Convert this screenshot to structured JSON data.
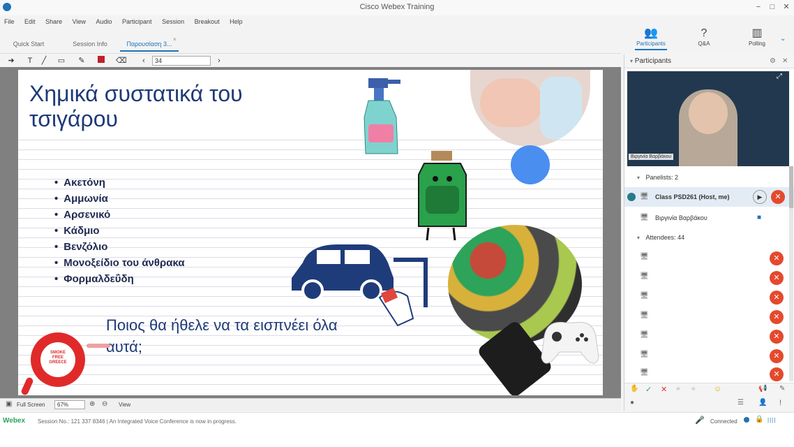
{
  "window": {
    "title": "Cisco Webex Training"
  },
  "menu": [
    "File",
    "Edit",
    "Share",
    "View",
    "Audio",
    "Participant",
    "Session",
    "Breakout",
    "Help"
  ],
  "tabs": [
    {
      "label": "Quick Start"
    },
    {
      "label": "Session Info"
    },
    {
      "label": "Παρουσίαση 3..."
    }
  ],
  "top_icons": [
    {
      "label": "Participants",
      "icon": "participants-icon"
    },
    {
      "label": "Q&A",
      "icon": "qa-icon"
    },
    {
      "label": "Polling",
      "icon": "polling-icon"
    }
  ],
  "annotation_toolbar": {
    "page_value": "34"
  },
  "slide": {
    "title": "Χημικά συστατικά του τσιγάρου",
    "bullets": [
      "Ακετόνη",
      "Αμμωνία",
      "Αρσενικό",
      "Κάδμιο",
      "Βενζόλιο",
      "Μονοξείδιο του άνθρακα",
      "Φορμαλδεΰδη"
    ],
    "question": "Ποιος θα ήθελε να τα εισπνέει όλα αυτά;",
    "logo_text": "SMOKE FREE GREECE"
  },
  "statusbar": {
    "fullscreen_label": "Full Screen",
    "zoom": "67%",
    "view_label": "View"
  },
  "footer": {
    "logo": "Webex",
    "session_text": "Session No.: 121 337 8346  |  An Integrated Voice Conference is now in progress.",
    "connected": "Connected"
  },
  "panel": {
    "title": "Participants",
    "video_name": "Βιργινία Βαρβάκου",
    "panelists_header": "Panelists: 2",
    "attendees_header": "Attendees: 44",
    "panelists": [
      {
        "name": "Class PSD261 (Host, me)"
      },
      {
        "name": "Βιργινία Βαρβάκου"
      }
    ],
    "attendee_rows": 7
  },
  "colors": {
    "accent": "#1f73b7",
    "mute_red": "#e5492d",
    "slide_title": "#1e3a78"
  }
}
